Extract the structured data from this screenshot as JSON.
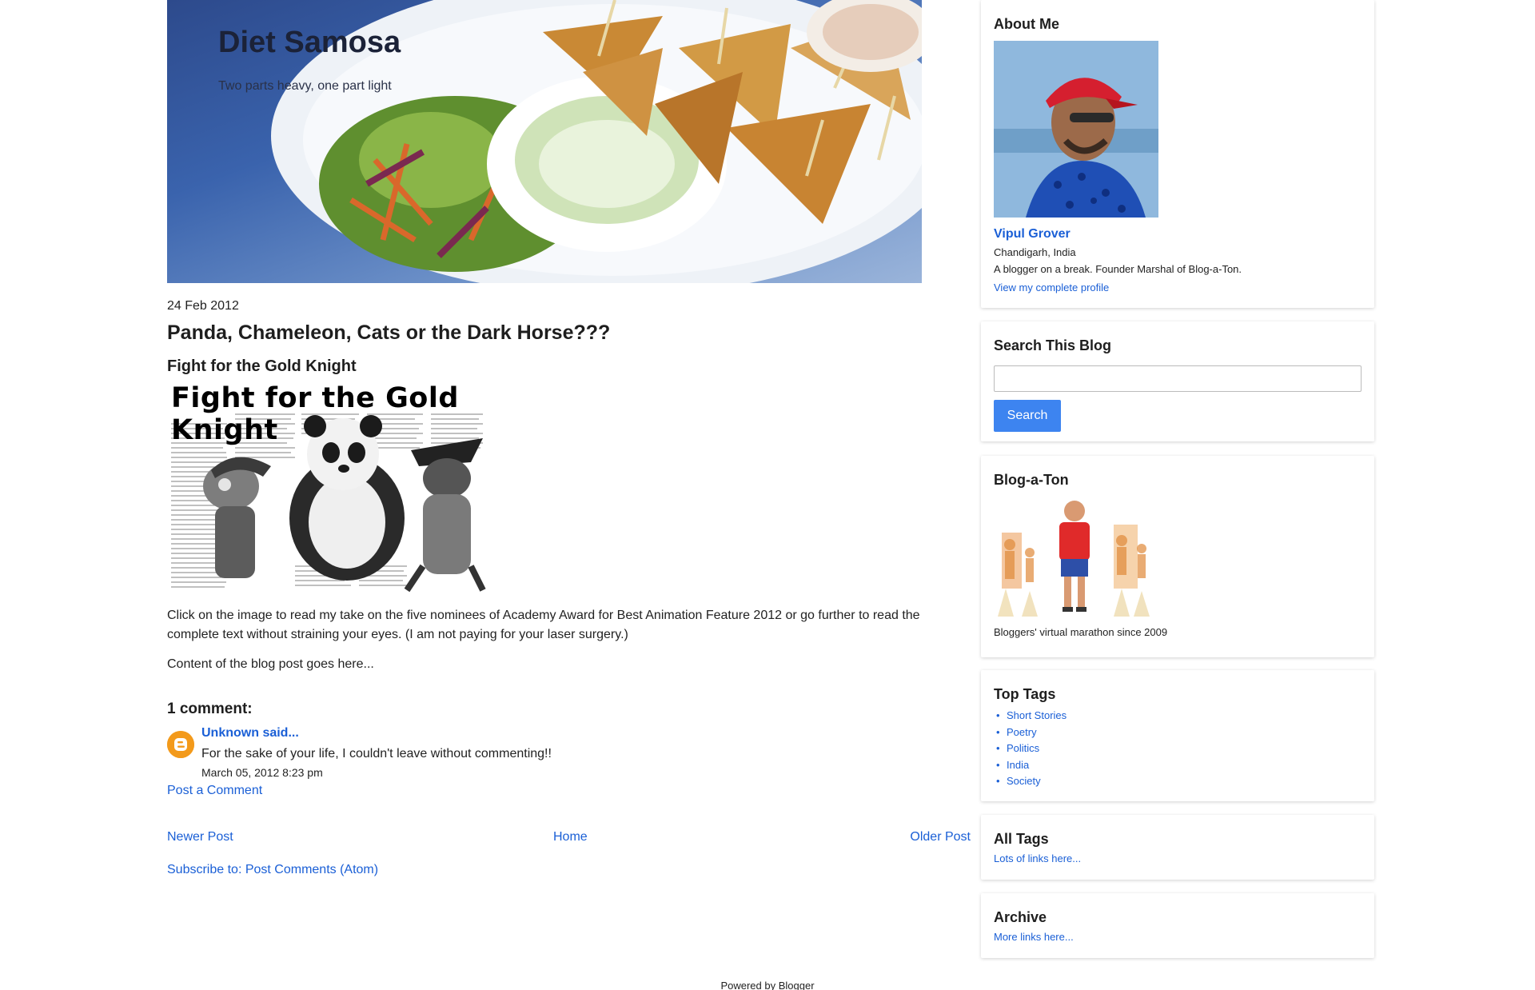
{
  "header": {
    "title": "Diet Samosa",
    "description": "Two parts heavy, one part light"
  },
  "post": {
    "date": "24 Feb 2012",
    "title": "Panda, Chameleon, Cats or the Dark Horse???",
    "subtitle": "Fight for the Gold Knight",
    "image_heading": "Fight for the Gold Knight",
    "intro": "Click on the image to read my take on the five nominees of Academy Award for Best Animation Feature 2012 or go further to read the complete text without straining your eyes. (I am not paying for your laser surgery.)",
    "body": "Content of the blog post goes here..."
  },
  "comments": {
    "header": "1 comment:",
    "items": [
      {
        "author": "Unknown said...",
        "text": "For the sake of your life, I couldn't leave without commenting!!",
        "date": "March 05, 2012 8:23 pm"
      }
    ],
    "post_link": "Post a Comment"
  },
  "nav": {
    "newer": "Newer Post",
    "home": "Home",
    "older": "Older Post",
    "subscribe": "Subscribe to: Post Comments (Atom)"
  },
  "sidebar": {
    "about": {
      "title": "About Me",
      "name": "Vipul Grover",
      "location": "Chandigarh, India",
      "bio": "A blogger on a break. Founder Marshal of Blog-a-Ton.",
      "profile_link": "View my complete profile"
    },
    "search": {
      "title": "Search This Blog",
      "button": "Search",
      "value": ""
    },
    "blogaton": {
      "title": "Blog-a-Ton",
      "caption": "Bloggers' virtual marathon since 2009"
    },
    "top_tags": {
      "title": "Top Tags",
      "items": [
        "Short Stories",
        "Poetry",
        "Politics",
        "India",
        "Society"
      ]
    },
    "all_tags": {
      "title": "All Tags",
      "link": "Lots of links here..."
    },
    "archive": {
      "title": "Archive",
      "link": "More links here..."
    }
  },
  "footer": {
    "text": "Powered by Blogger"
  },
  "colors": {
    "link": "#1a5fd6",
    "search_button": "#3d84f0",
    "avatar": "#f39a1b"
  },
  "icons": {
    "commenter_avatar": "blogger-icon"
  }
}
